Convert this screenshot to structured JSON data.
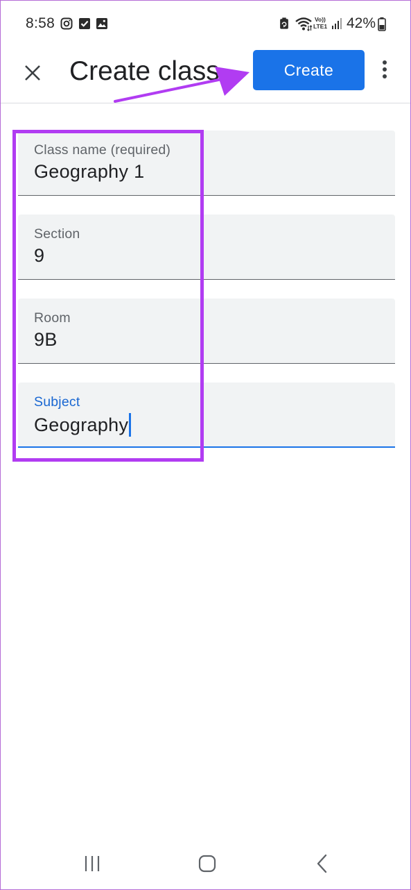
{
  "status_bar": {
    "time": "8:58",
    "battery_percent": "42%",
    "icons": [
      "instagram-icon",
      "checkbox-icon",
      "gallery-icon",
      "battery-saver-icon",
      "wifi-icon",
      "volte-icon",
      "signal-icon",
      "battery-icon"
    ]
  },
  "app_bar": {
    "title": "Create class",
    "create_label": "Create",
    "close_icon": "close-icon",
    "more_icon": "more-vert-icon"
  },
  "form": {
    "fields": [
      {
        "label": "Class name (required)",
        "value": "Geography 1"
      },
      {
        "label": "Section",
        "value": "9"
      },
      {
        "label": "Room",
        "value": "9B"
      },
      {
        "label": "Subject",
        "value": "Geography",
        "focused": true
      }
    ]
  },
  "annotation": {
    "color": "#b13cf2"
  },
  "colors": {
    "accent": "#1a73e8",
    "field_bg": "#f1f3f4",
    "annotation": "#b13cf2"
  },
  "nav_bar": {
    "icons": [
      "recent-apps-icon",
      "home-icon",
      "back-icon"
    ]
  }
}
